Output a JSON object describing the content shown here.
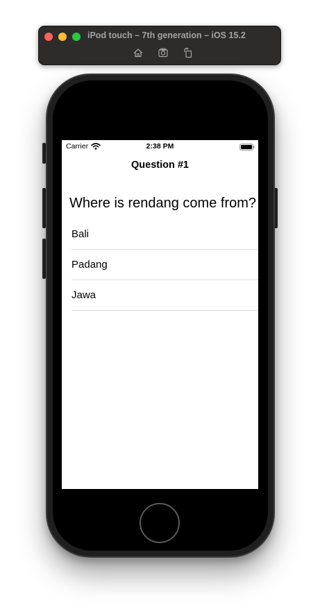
{
  "simulator": {
    "title": "iPod touch – 7th generation – iOS 15.2",
    "toolbar": [
      "home-icon",
      "screenshot-icon",
      "rotate-icon"
    ]
  },
  "status_bar": {
    "carrier": "Carrier",
    "time": "2:38 PM"
  },
  "nav": {
    "title": "Question #1"
  },
  "question": {
    "text": "Where is rendang come from?"
  },
  "answers": [
    {
      "label": "Bali"
    },
    {
      "label": "Padang"
    },
    {
      "label": "Jawa"
    }
  ],
  "colors": {
    "titlebar_bg": "#2e2b2b",
    "close": "#fe5f57",
    "minimize": "#febc2e",
    "maximize": "#28c840",
    "device_body": "#1f1f20",
    "separator": "#dcdcde"
  }
}
